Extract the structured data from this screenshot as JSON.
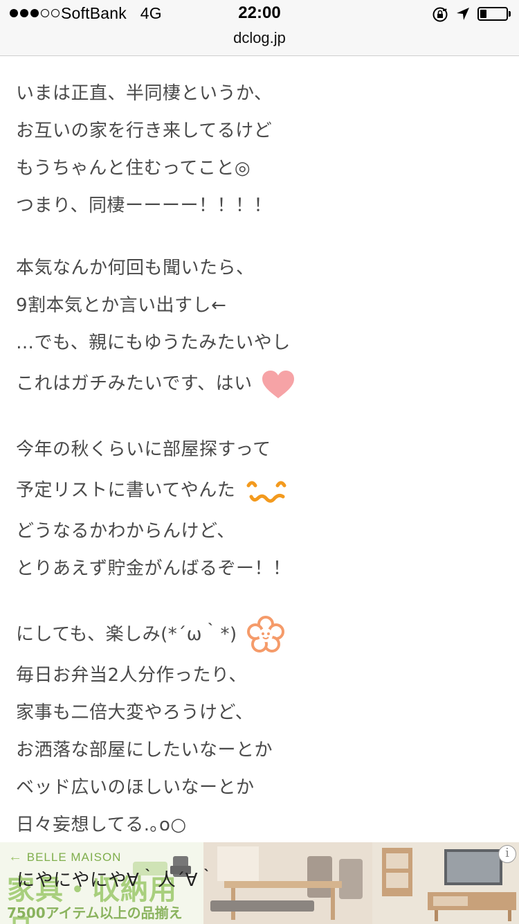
{
  "status_bar": {
    "carrier": "SoftBank",
    "network": "4G",
    "time": "22:00",
    "signal_bars_filled": 3,
    "signal_bars_total": 5,
    "battery_level": 0.25
  },
  "browser": {
    "url": "dclog.jp"
  },
  "article": {
    "lines": [
      "いまは正直、半同棲というか、",
      "お互いの家を行き来してるけど",
      "もうちゃんと住むってこと◎",
      "つまり、同棲ーーーー！！！！",
      "本気なんか何回も聞いたら、",
      "9割本気とか言い出すし←",
      "…でも、親にもゆうたみたいやし",
      "これはガチみたいです、はい",
      "今年の秋くらいに部屋探すって",
      "予定リストに書いてやんた",
      "どうなるかわからんけど、",
      "とりあえず貯金がんばるぞー！！",
      "にしても、楽しみ(*´ω｀*)",
      "毎日お弁当2人分作ったり、",
      "家事も二倍大変やろうけど、",
      "お洒落な部屋にしたいなーとか",
      "ベッド広いのほしいなーとか",
      "日々妄想してる.｡o○"
    ],
    "emoji": {
      "heart": "heart-icon",
      "smile": "smile-face-icon",
      "flower": "flower-icon"
    }
  },
  "ad": {
    "brand": "BELLE MAISON",
    "headline": "家具・収納用品",
    "subline": "7500アイテム以上の品揃え",
    "overlay_text": "にやにやにや∀｀人´∀｀",
    "info_glyph": "i"
  },
  "colors": {
    "text": "#4a4a4a",
    "heart": "#f6a3a6",
    "smile": "#f39a1e",
    "flower": "#f59b6a",
    "brand_green": "#8ab35e"
  }
}
